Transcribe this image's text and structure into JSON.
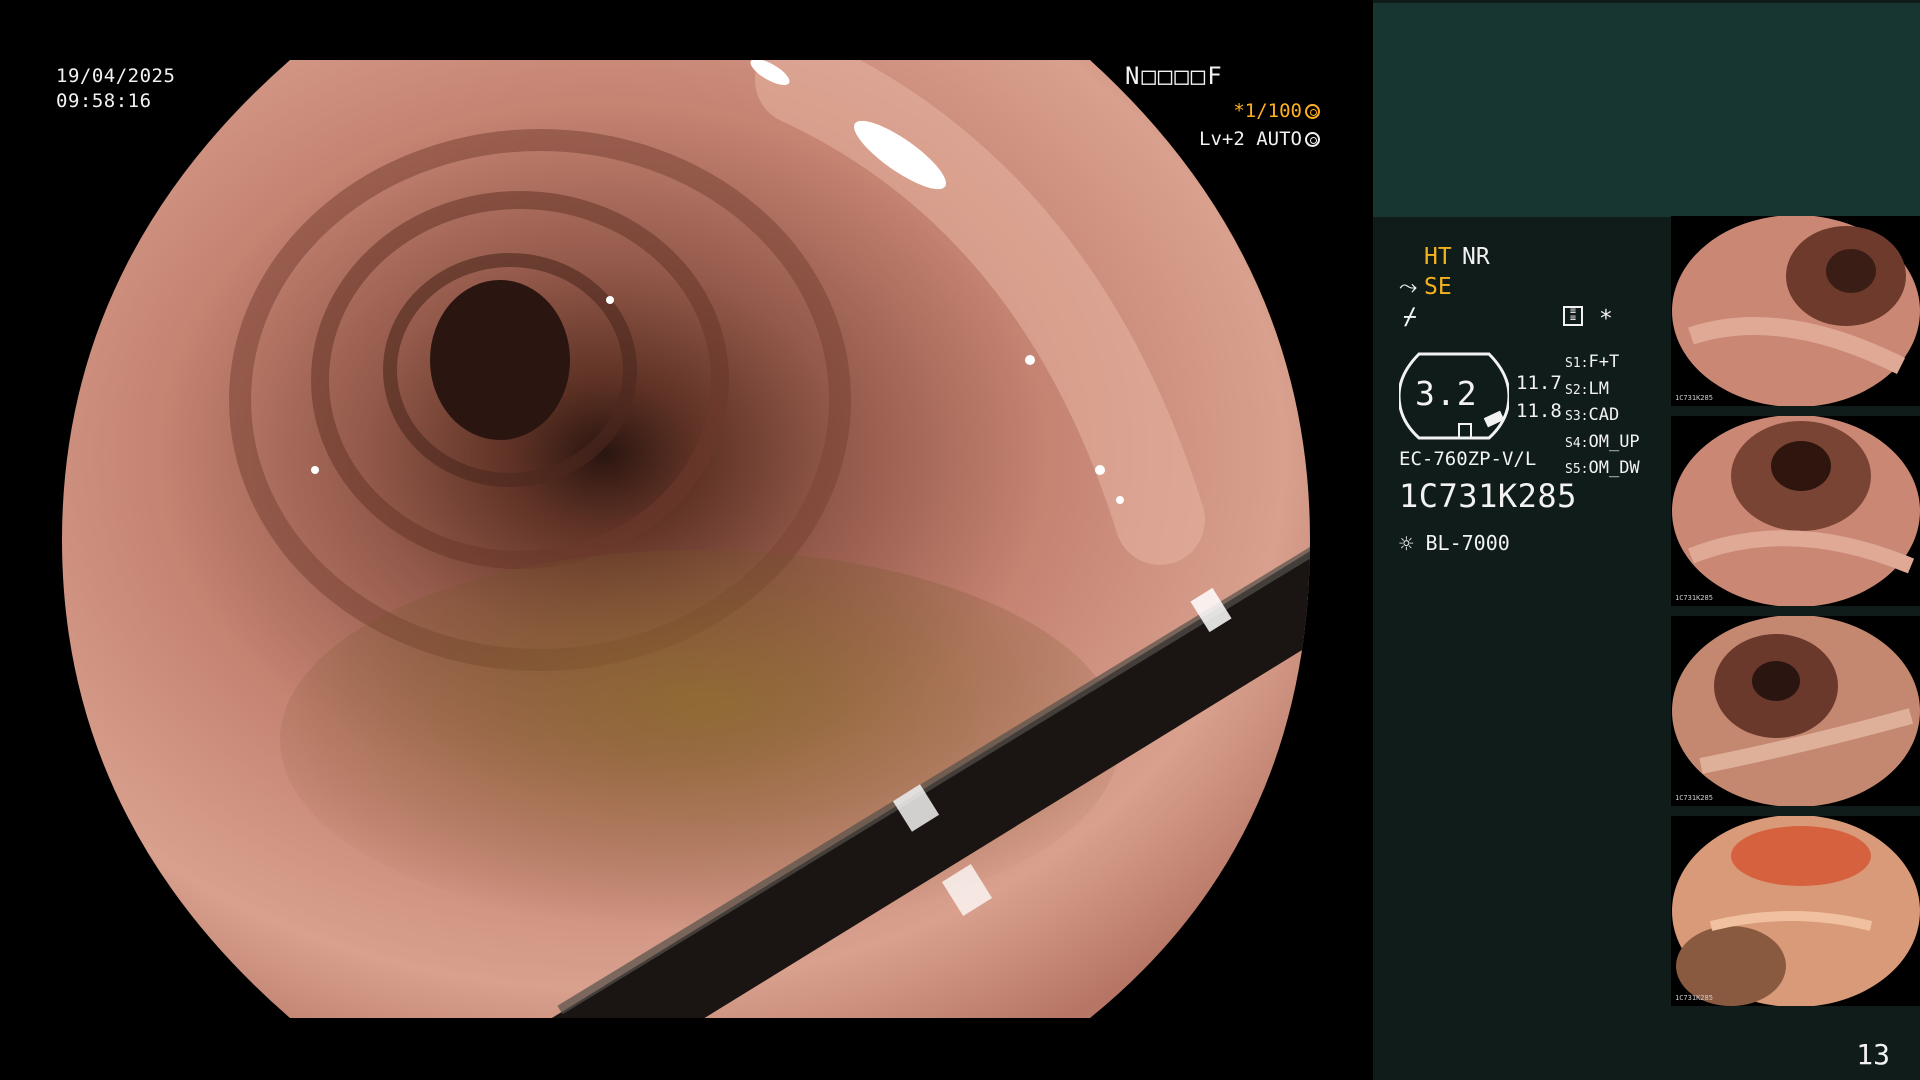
{
  "overlay": {
    "date": "19/04/2025",
    "time": "09:58:16",
    "patient_id": "N□□□□F",
    "shutter": "*1/100",
    "level": "Lv+2 AUTO"
  },
  "panel": {
    "ht": "HT",
    "nr": "NR",
    "se": "SE",
    "star": "*",
    "ratio": "3.2",
    "val_upper": "11.7",
    "val_lower": "11.8",
    "scope_model": "EC-760ZP-V/L",
    "serial": "1C731K285",
    "lamp": "BL-7000",
    "settings": [
      {
        "key": "S1:",
        "value": "F+T"
      },
      {
        "key": "S2:",
        "value": "LM"
      },
      {
        "key": "S3:",
        "value": "CAD"
      },
      {
        "key": "S4:",
        "value": "OM_UP"
      },
      {
        "key": "S5:",
        "value": "OM_DW"
      }
    ],
    "thumbnail_serial": "1C731K285",
    "page_number": "13"
  },
  "colors": {
    "panel_bg": "#0f1c1a",
    "panel_top": "#173632",
    "accent_yellow": "#f4b21d",
    "mucosa": "#c98774"
  }
}
